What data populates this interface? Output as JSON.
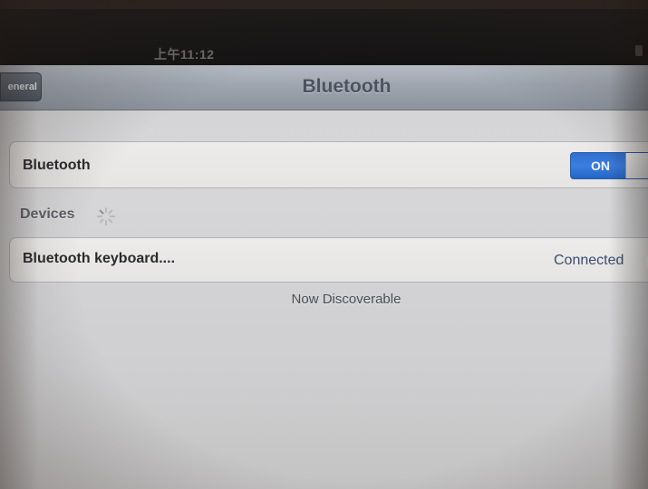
{
  "status_bar": {
    "time": "上午11:12"
  },
  "nav": {
    "back_label": "eneral",
    "title": "Bluetooth"
  },
  "bluetooth_row": {
    "label": "Bluetooth",
    "toggle_state": "ON"
  },
  "devices_section": {
    "header": "Devices",
    "items": [
      {
        "name": "Bluetooth keyboard....",
        "status": "Connected"
      }
    ]
  },
  "footer": {
    "text": "Now Discoverable"
  },
  "colors": {
    "toggle_on": "#2f6fd0",
    "nav_bar": "#9ea5af",
    "background": "#d4d4d6"
  }
}
